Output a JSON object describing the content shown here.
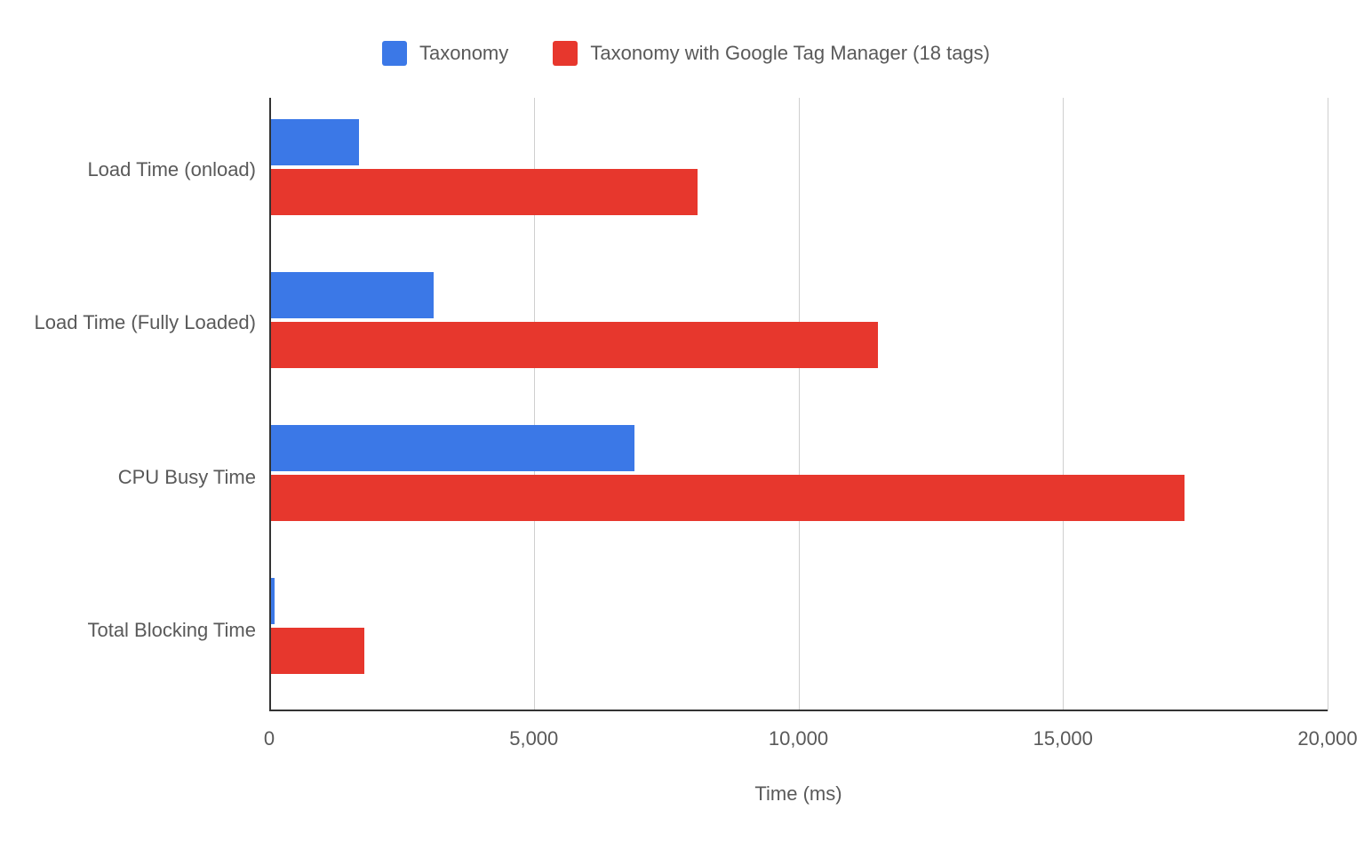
{
  "legend": {
    "series1": "Taxonomy",
    "series2": "Taxonomy with Google Tag Manager (18 tags)"
  },
  "xaxis": {
    "title": "Time (ms)",
    "t0": "0",
    "t1": "5,000",
    "t2": "10,000",
    "t3": "15,000",
    "t4": "20,000"
  },
  "categories": {
    "c0": "Load Time (onload)",
    "c1": "Load Time (Fully Loaded)",
    "c2": "CPU Busy Time",
    "c3": "Total Blocking Time"
  },
  "chart_data": {
    "type": "bar",
    "orientation": "horizontal",
    "xlabel": "Time (ms)",
    "ylabel": "",
    "xlim": [
      0,
      20000
    ],
    "categories": [
      "Load Time (onload)",
      "Load Time (Fully Loaded)",
      "CPU Busy Time",
      "Total Blocking Time"
    ],
    "series": [
      {
        "name": "Taxonomy",
        "color": "#3b78e7",
        "values": [
          1700,
          3100,
          6900,
          100
        ]
      },
      {
        "name": "Taxonomy with Google Tag Manager (18 tags)",
        "color": "#e7372d",
        "values": [
          8100,
          11500,
          17300,
          1800
        ]
      }
    ],
    "legend_position": "top",
    "grid": {
      "x": true,
      "y": false
    }
  }
}
